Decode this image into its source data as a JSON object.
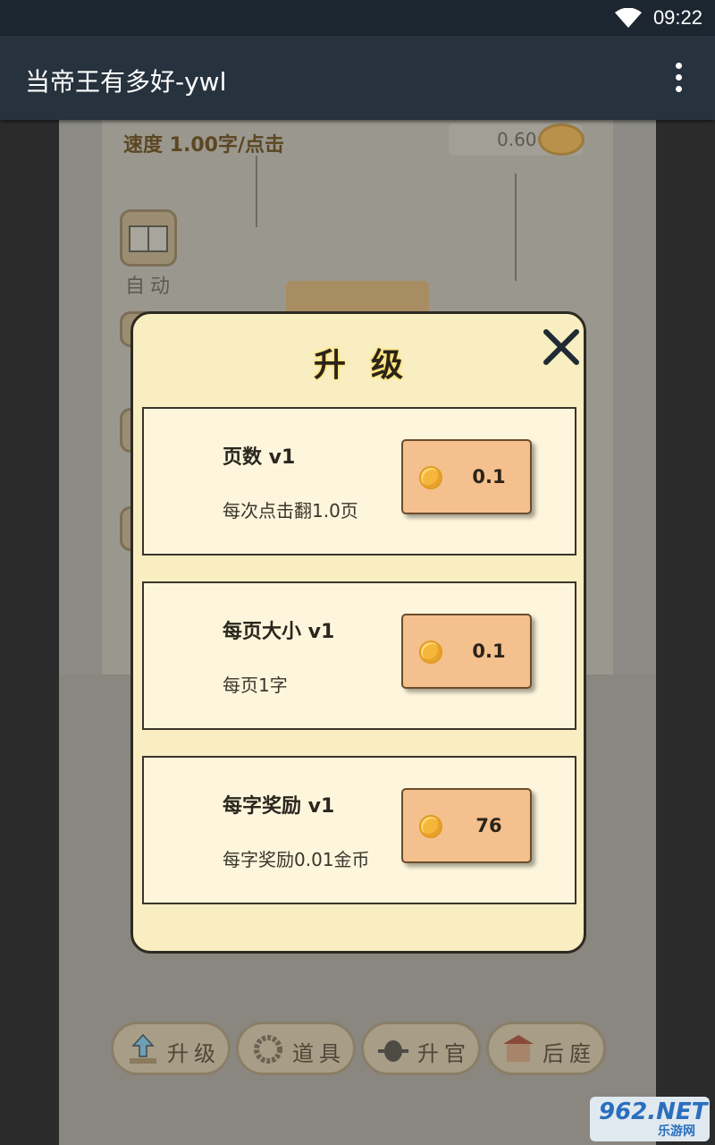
{
  "status_bar": {
    "time": "09:22"
  },
  "app_bar": {
    "title": "当帝王有多好-ywl"
  },
  "game": {
    "speed_text": "速度 1.00字/点击",
    "coins": "0.60",
    "side_buttons": [
      {
        "label": "自动"
      }
    ],
    "bottom_nav": [
      {
        "label": "升级",
        "icon": "upload-book-icon"
      },
      {
        "label": "道具",
        "icon": "beads-icon"
      },
      {
        "label": "升官",
        "icon": "official-hat-icon"
      },
      {
        "label": "后庭",
        "icon": "palace-icon"
      }
    ]
  },
  "dialog": {
    "title": "升级",
    "items": [
      {
        "name": "页数 v1",
        "desc": "每次点击翻1.0页",
        "price": "0.1"
      },
      {
        "name": "每页大小 v1",
        "desc": "每页1字",
        "price": "0.1"
      },
      {
        "name": "每字奖励 v1",
        "desc": "每字奖励0.01金币",
        "price": "76"
      }
    ]
  },
  "watermark": {
    "main": "962.NET",
    "sub": "乐游网"
  },
  "colors": {
    "dialog_bg": "#f9eec1",
    "card_bg": "#fdf6dc",
    "buy_button": "#f4c08e",
    "coin": "#f5b73a",
    "app_bar": "#26323d"
  }
}
